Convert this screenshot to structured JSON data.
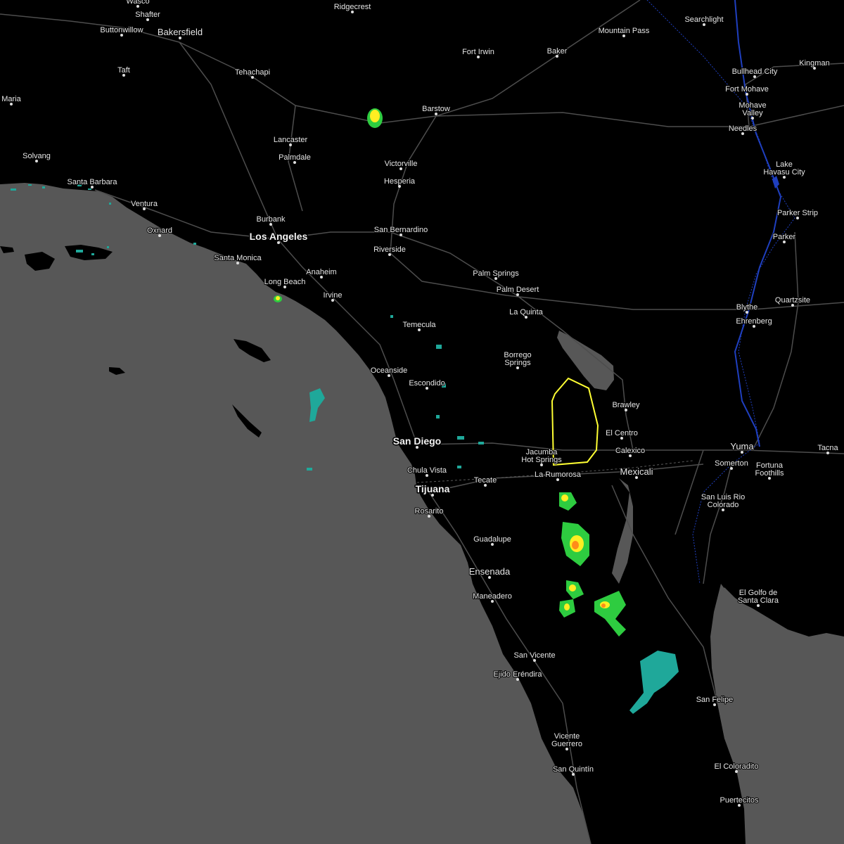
{
  "colors": {
    "water": "#575757",
    "land": "#000000",
    "road": "#4a4a4a",
    "warning_polygon": "#ffff33",
    "radar_light": "#1fa89a",
    "radar_mid": "#2ecc40",
    "radar_yellow": "#ffee22",
    "radar_orange": "#ff8c1a",
    "border": "#1f3fbf"
  },
  "warning": {
    "type": "severe-thunderstorm-warning-polygon"
  },
  "cities": [
    {
      "id": "wasco",
      "name": "Wasco"
    },
    {
      "id": "shafter",
      "name": "Shafter"
    },
    {
      "id": "buttonwillow",
      "name": "Buttonwillow"
    },
    {
      "id": "bakersfield",
      "name": "Bakersfield"
    },
    {
      "id": "taft",
      "name": "Taft"
    },
    {
      "id": "tehachapi",
      "name": "Tehachapi"
    },
    {
      "id": "ridgecrest",
      "name": "Ridgecrest"
    },
    {
      "id": "maria",
      "name": "Maria"
    },
    {
      "id": "solvang",
      "name": "Solvang"
    },
    {
      "id": "santa-barbara",
      "name": "Santa Barbara"
    },
    {
      "id": "ventura",
      "name": "Ventura"
    },
    {
      "id": "oxnard",
      "name": "Oxnard"
    },
    {
      "id": "lancaster",
      "name": "Lancaster"
    },
    {
      "id": "palmdale",
      "name": "Palmdale"
    },
    {
      "id": "burbank",
      "name": "Burbank"
    },
    {
      "id": "los-angeles",
      "name": "Los Angeles"
    },
    {
      "id": "santa-monica",
      "name": "Santa Monica"
    },
    {
      "id": "long-beach",
      "name": "Long Beach"
    },
    {
      "id": "anaheim",
      "name": "Anaheim"
    },
    {
      "id": "irvine",
      "name": "Irvine"
    },
    {
      "id": "victorville",
      "name": "Victorville"
    },
    {
      "id": "hesperia",
      "name": "Hesperia"
    },
    {
      "id": "san-bernardino",
      "name": "San Bernardino"
    },
    {
      "id": "riverside",
      "name": "Riverside"
    },
    {
      "id": "temecula",
      "name": "Temecula"
    },
    {
      "id": "oceanside",
      "name": "Oceanside"
    },
    {
      "id": "escondido",
      "name": "Escondido"
    },
    {
      "id": "san-diego",
      "name": "San Diego"
    },
    {
      "id": "chula-vista",
      "name": "Chula Vista"
    },
    {
      "id": "tijuana",
      "name": "Tijuana"
    },
    {
      "id": "rosarito",
      "name": "Rosarito"
    },
    {
      "id": "tecate",
      "name": "Tecate"
    },
    {
      "id": "guadalupe",
      "name": "Guadalupe"
    },
    {
      "id": "ensenada",
      "name": "Ensenada"
    },
    {
      "id": "maneadero",
      "name": "Maneadero"
    },
    {
      "id": "san-vicente",
      "name": "San Vicente"
    },
    {
      "id": "ejido-erendira",
      "name": "Ejido Eréndira"
    },
    {
      "id": "vicente-guerrero",
      "name": "Vicente\nGuerrero"
    },
    {
      "id": "san-quintin",
      "name": "San Quintín"
    },
    {
      "id": "barstow",
      "name": "Barstow"
    },
    {
      "id": "fort-irwin",
      "name": "Fort Irwin"
    },
    {
      "id": "baker",
      "name": "Baker"
    },
    {
      "id": "mountain-pass",
      "name": "Mountain Pass"
    },
    {
      "id": "searchlight",
      "name": "Searchlight"
    },
    {
      "id": "bullhead-city",
      "name": "Bullhead City"
    },
    {
      "id": "fort-mohave",
      "name": "Fort Mohave"
    },
    {
      "id": "mohave-valley",
      "name": "Mohave\nValley"
    },
    {
      "id": "needles",
      "name": "Needles"
    },
    {
      "id": "kingman",
      "name": "Kingman"
    },
    {
      "id": "lake-havasu-city",
      "name": "Lake\nHavasu City"
    },
    {
      "id": "parker-strip",
      "name": "Parker Strip"
    },
    {
      "id": "parker",
      "name": "Parker"
    },
    {
      "id": "palm-springs",
      "name": "Palm Springs"
    },
    {
      "id": "palm-desert",
      "name": "Palm Desert"
    },
    {
      "id": "la-quinta",
      "name": "La Quinta"
    },
    {
      "id": "borrego-springs",
      "name": "Borrego\nSprings"
    },
    {
      "id": "brawley",
      "name": "Brawley"
    },
    {
      "id": "el-centro",
      "name": "El Centro"
    },
    {
      "id": "calexico",
      "name": "Calexico"
    },
    {
      "id": "mexicali",
      "name": "Mexicali"
    },
    {
      "id": "jacumba",
      "name": "Jacumba\nHot Springs"
    },
    {
      "id": "la-rumorosa",
      "name": "La Rumorosa"
    },
    {
      "id": "blythe",
      "name": "Blythe"
    },
    {
      "id": "ehrenberg",
      "name": "Ehrenberg"
    },
    {
      "id": "quartzsite",
      "name": "Quartzsite"
    },
    {
      "id": "yuma",
      "name": "Yuma"
    },
    {
      "id": "tacna",
      "name": "Tacna"
    },
    {
      "id": "somerton",
      "name": "Somerton"
    },
    {
      "id": "fortuna-foothills",
      "name": "Fortuna\nFoothills"
    },
    {
      "id": "san-luis-rio-colorado",
      "name": "San Luis Rio\nColorado"
    },
    {
      "id": "el-golfo",
      "name": "El Golfo de\nSanta Clara"
    },
    {
      "id": "san-felipe",
      "name": "San Felipe"
    },
    {
      "id": "el-coloradito",
      "name": "El Coloradito"
    },
    {
      "id": "puertecitos",
      "name": "Puertecitos"
    }
  ]
}
